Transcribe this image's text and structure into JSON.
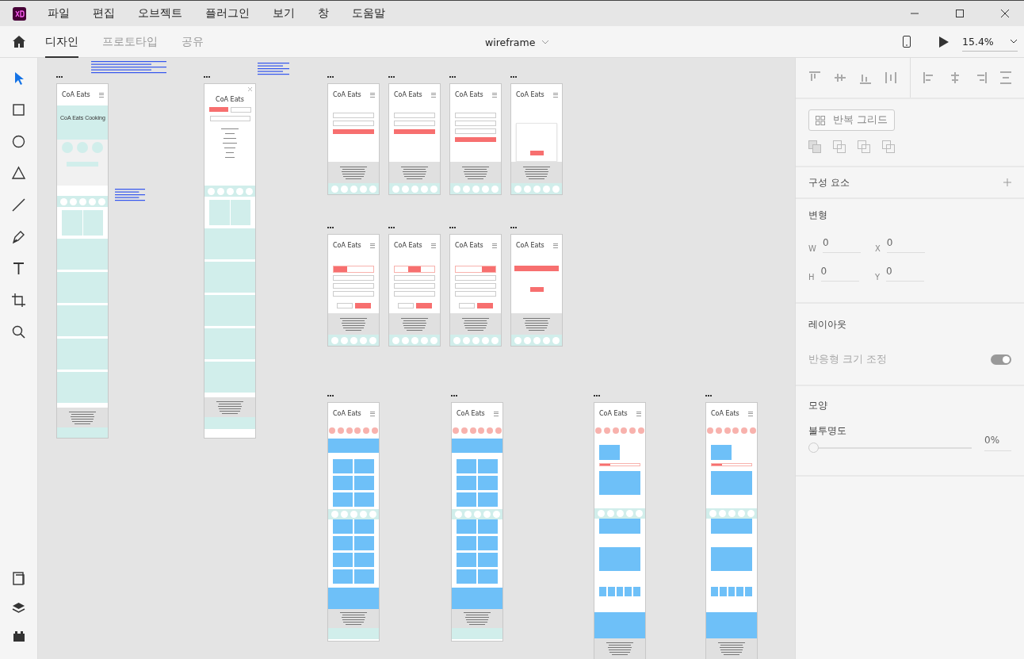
{
  "menu_bar": {
    "items": [
      "파일",
      "편집",
      "오브젝트",
      "플러그인",
      "보기",
      "창",
      "도움말"
    ]
  },
  "tabs": [
    {
      "label": "디자인",
      "selected": true
    },
    {
      "label": "프로토타입",
      "selected": false
    },
    {
      "label": "공유",
      "selected": false
    }
  ],
  "document": {
    "title": "wireframe",
    "zoom": "15.4%"
  },
  "tools": [
    {
      "kind": "select",
      "selected": true
    },
    {
      "kind": "rectangle",
      "selected": false
    },
    {
      "kind": "ellipse",
      "selected": false
    },
    {
      "kind": "polygon",
      "selected": false
    },
    {
      "kind": "line",
      "selected": false
    },
    {
      "kind": "pen",
      "selected": false
    },
    {
      "kind": "text",
      "selected": false
    },
    {
      "kind": "artboard",
      "selected": false
    },
    {
      "kind": "zoom",
      "selected": false
    }
  ],
  "artboards": [
    {
      "kind": "home",
      "title": "CoA Eats",
      "heading": "CoA Eats Cooking"
    },
    {
      "kind": "menu",
      "title": "CoA Eats"
    },
    {
      "kind": "login",
      "title": "CoA Eats"
    },
    {
      "kind": "find",
      "title": "CoA Eats"
    },
    {
      "kind": "signup",
      "title": "CoA Eats"
    },
    {
      "kind": "popup",
      "title": "CoA Eats"
    },
    {
      "kind": "step",
      "title": "CoA Eats"
    },
    {
      "kind": "step",
      "title": "CoA Eats"
    },
    {
      "kind": "step",
      "title": "CoA Eats"
    },
    {
      "kind": "done",
      "title": "CoA Eats"
    },
    {
      "kind": "list",
      "title": "CoA Eats"
    },
    {
      "kind": "list",
      "title": "CoA Eats"
    },
    {
      "kind": "detail",
      "title": "CoA Eats"
    },
    {
      "kind": "detail",
      "title": "CoA Eats"
    }
  ],
  "panel": {
    "repeat_grid": "반복 그리드",
    "components": "구성 요소",
    "transform": {
      "title": "변형",
      "fields": [
        {
          "label": "W",
          "value": "0"
        },
        {
          "label": "X",
          "value": "0"
        },
        {
          "label": "H",
          "value": "0"
        },
        {
          "label": "Y",
          "value": "0"
        }
      ]
    },
    "layout": {
      "title": "레이아웃",
      "responsive_label": "반응형 크기 조정",
      "responsive_on": true
    },
    "appearance": {
      "title": "모양",
      "opacity_label": "불투명도",
      "level": 0,
      "opacity_value": "0%"
    }
  }
}
